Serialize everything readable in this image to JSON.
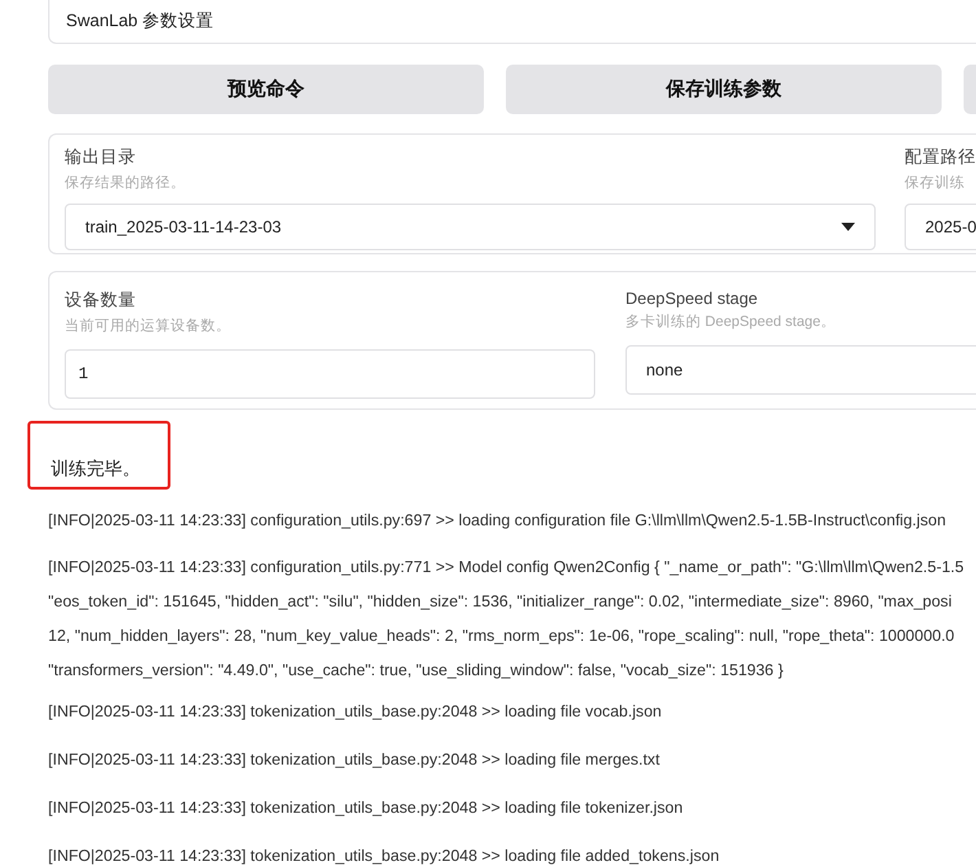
{
  "swanlab_section": {
    "title": "SwanLab 参数设置"
  },
  "buttons": [
    {
      "label": "预览命令"
    },
    {
      "label": "保存训练参数"
    }
  ],
  "output_panel": {
    "fields": [
      {
        "label": "输出目录",
        "hint": "保存结果的路径。",
        "value": "train_2025-03-11-14-23-03",
        "kind": "dropdown"
      },
      {
        "label": "配置路径",
        "hint": "保存训练",
        "value": "2025-0",
        "kind": "text"
      }
    ]
  },
  "device_panel": {
    "fields": [
      {
        "label": "设备数量",
        "hint": "当前可用的运算设备数。",
        "value": "1",
        "kind": "number"
      },
      {
        "label": "DeepSpeed stage",
        "hint": "多卡训练的 DeepSpeed stage。",
        "value": "none",
        "kind": "text"
      }
    ]
  },
  "status": {
    "text": "训练完毕。",
    "highlighted": true
  },
  "log": [
    {
      "lines": [
        "[INFO|2025-03-11 14:23:33] configuration_utils.py:697 >> loading configuration file G:\\llm\\llm\\Qwen2.5-1.5B-Instruct\\config.json"
      ]
    },
    {
      "lines": [
        "[INFO|2025-03-11 14:23:33] configuration_utils.py:771 >> Model config Qwen2Config { \"_name_or_path\": \"G:\\llm\\llm\\Qwen2.5-1.5",
        "\"eos_token_id\": 151645, \"hidden_act\": \"silu\", \"hidden_size\": 1536, \"initializer_range\": 0.02, \"intermediate_size\": 8960, \"max_posi",
        "12, \"num_hidden_layers\": 28, \"num_key_value_heads\": 2, \"rms_norm_eps\": 1e-06, \"rope_scaling\": null, \"rope_theta\": 1000000.0",
        "\"transformers_version\": \"4.49.0\", \"use_cache\": true, \"use_sliding_window\": false, \"vocab_size\": 151936 }"
      ]
    },
    {
      "lines": [
        "[INFO|2025-03-11 14:23:33] tokenization_utils_base.py:2048 >> loading file vocab.json"
      ]
    },
    {
      "lines": [
        "[INFO|2025-03-11 14:23:33] tokenization_utils_base.py:2048 >> loading file merges.txt"
      ]
    },
    {
      "lines": [
        "[INFO|2025-03-11 14:23:33] tokenization_utils_base.py:2048 >> loading file tokenizer.json"
      ]
    },
    {
      "lines": [
        "[INFO|2025-03-11 14:23:33] tokenization_utils_base.py:2048 >> loading file added_tokens.json"
      ]
    }
  ]
}
